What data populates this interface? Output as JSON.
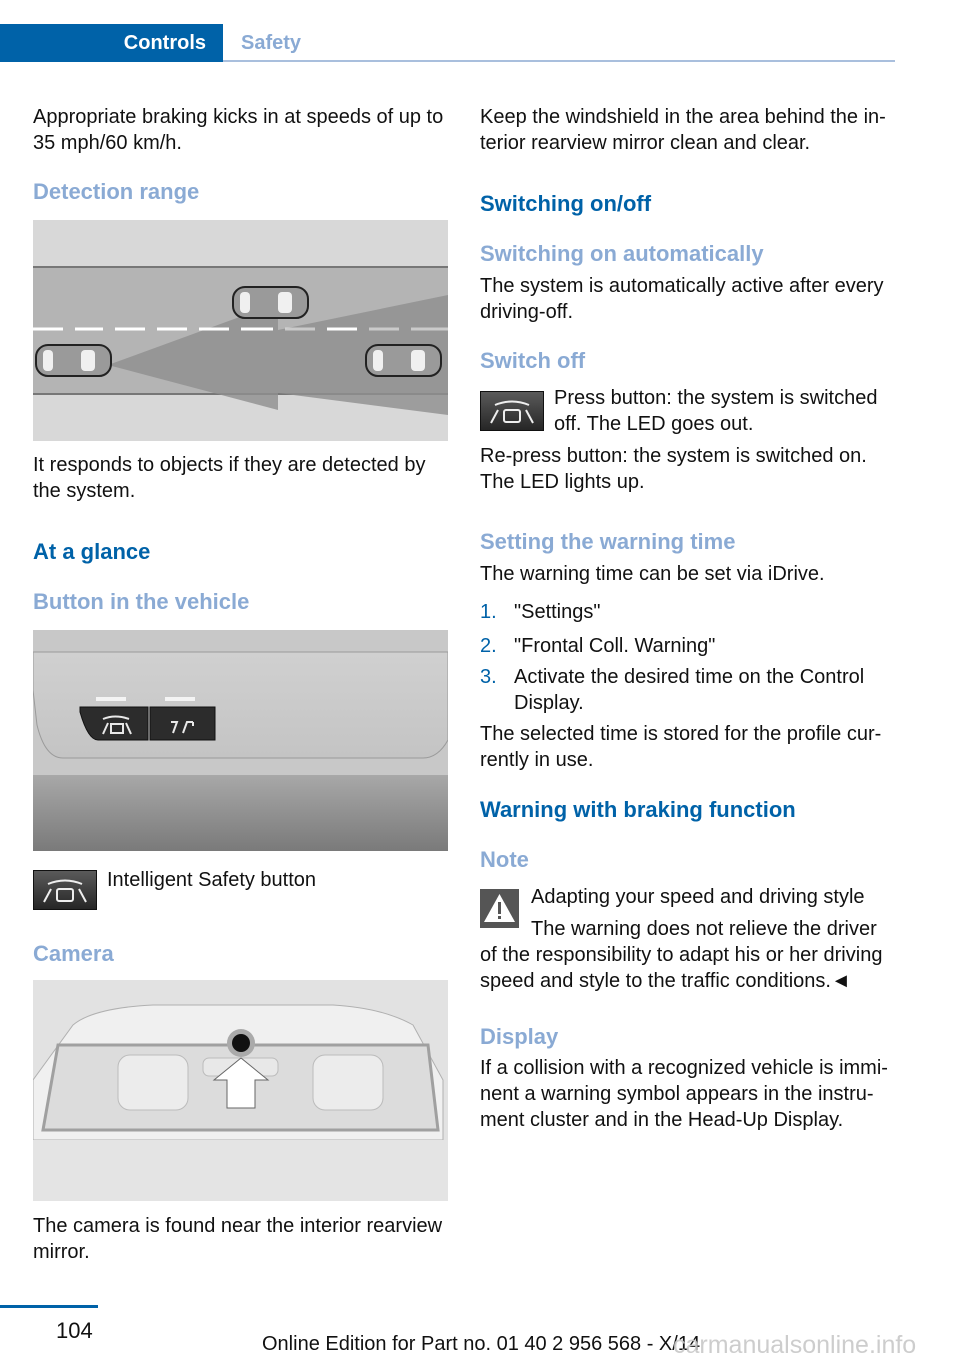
{
  "header": {
    "tab_active": "Controls",
    "tab_inactive": "Safety"
  },
  "left": {
    "intro": [
      "Appropriate braking kicks in at speeds of up to",
      "35 mph/60 km/h."
    ],
    "detection_heading": "Detection range",
    "detection_caption": [
      "It responds to objects if they are detected by",
      "the system."
    ],
    "at_a_glance": "At a glance",
    "button_heading": "Button in the vehicle",
    "button_caption": "Intelligent Safety button",
    "camera_heading": "Camera",
    "camera_caption": [
      "The camera is found near the interior rearview",
      "mirror."
    ]
  },
  "right": {
    "windshield": [
      "Keep the windshield in the area behind the in-",
      "terior rearview mirror clean and clear."
    ],
    "switching_heading": "Switching on/off",
    "auto_heading": "Switching on automatically",
    "auto_text": [
      "The system is automatically active after every",
      "driving-off."
    ],
    "switch_off_heading": "Switch off",
    "press_text": [
      "Press button: the system is switched",
      "off. The LED goes out."
    ],
    "repress_text": [
      "Re-press button: the system is switched on.",
      "The LED lights up."
    ],
    "warning_time_heading": "Setting the warning time",
    "warning_time_text": "The warning time can be set via iDrive.",
    "steps": [
      {
        "num": "1.",
        "text": [
          "\"Settings\""
        ]
      },
      {
        "num": "2.",
        "text": [
          "\"Frontal Coll. Warning\""
        ]
      },
      {
        "num": "3.",
        "text": [
          "Activate the desired time on the Control",
          "Display."
        ]
      }
    ],
    "stored_text": [
      "The selected time is stored for the profile cur-",
      "rently in use."
    ],
    "braking_heading": "Warning with braking function",
    "note_heading": "Note",
    "note_title": "Adapting your speed and driving style",
    "note_text": [
      "The warning does not relieve the driver",
      "of the responsibility to adapt his or her driving",
      "speed and style to the traffic conditions.◄"
    ],
    "display_heading": "Display",
    "display_text": [
      "If a collision with a recognized vehicle is immi-",
      "nent a warning symbol appears in the instru-",
      "ment cluster and in the Head-Up Display."
    ]
  },
  "footer": {
    "page_number": "104",
    "edition": "Online Edition for Part no. 01 40 2 956 568 - X/14",
    "watermark": "carmanualsonline.info"
  },
  "colors": {
    "brand_blue": "#0062a8",
    "light_blue": "#8aaad4"
  }
}
